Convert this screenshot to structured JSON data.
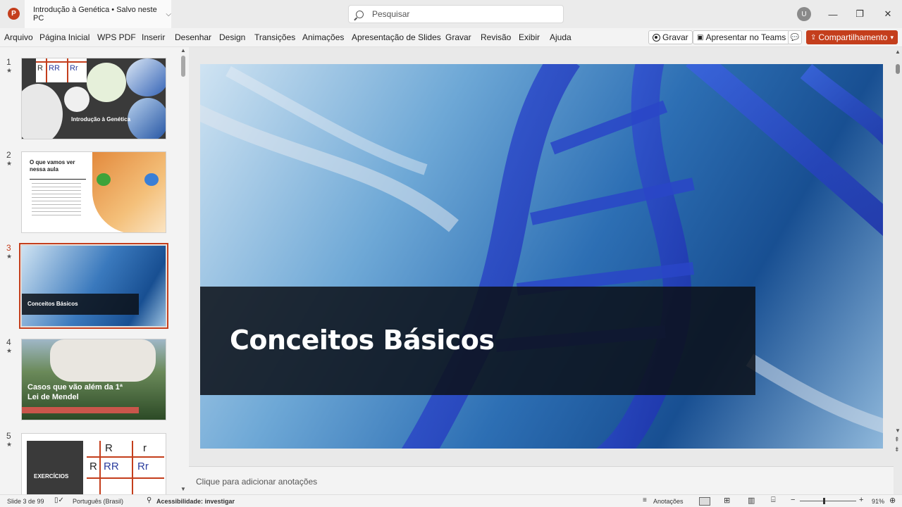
{
  "app": {
    "icon_letter": "P",
    "doc_title": "Introdução à Genética • Salvo neste PC",
    "search_placeholder": "Pesquisar",
    "user_initial": "U"
  },
  "menu": {
    "items": [
      "Arquivo",
      "Página Inicial",
      "WPS PDF",
      "Inserir",
      "Desenhar",
      "Design",
      "Transições",
      "Animações",
      "Apresentação de Slides",
      "Gravar",
      "Revisão",
      "Exibir",
      "Ajuda"
    ],
    "record_label": "Gravar",
    "present_teams_label": "Apresentar no Teams",
    "share_label": "Compartilhamento"
  },
  "thumbnails": [
    {
      "num": "1",
      "title": "Introdução à Genética",
      "cells": [
        "R",
        "RR",
        "Rr"
      ]
    },
    {
      "num": "2",
      "title_line1": "O que vamos ver",
      "title_line2": "nessa aula"
    },
    {
      "num": "3",
      "title": "Conceitos Básicos"
    },
    {
      "num": "4",
      "title_line1": "Casos que vão além da 1ª",
      "title_line2": "Lei de Mendel"
    },
    {
      "num": "5",
      "title": "EXERCÍCIOS",
      "cells": [
        "R",
        "r",
        "R",
        "RR",
        "Rr"
      ]
    }
  ],
  "slide": {
    "title": "Conceitos Básicos",
    "colors": {
      "band": "#0c1018",
      "accent": "#c43e1c"
    }
  },
  "notes": {
    "placeholder": "Clique para adicionar anotações"
  },
  "status": {
    "slide_info": "Slide 3 de 99",
    "language": "Português (Brasil)",
    "accessibility": "Acessibilidade: investigar",
    "notes_label": "Anotações",
    "zoom": "91%"
  }
}
